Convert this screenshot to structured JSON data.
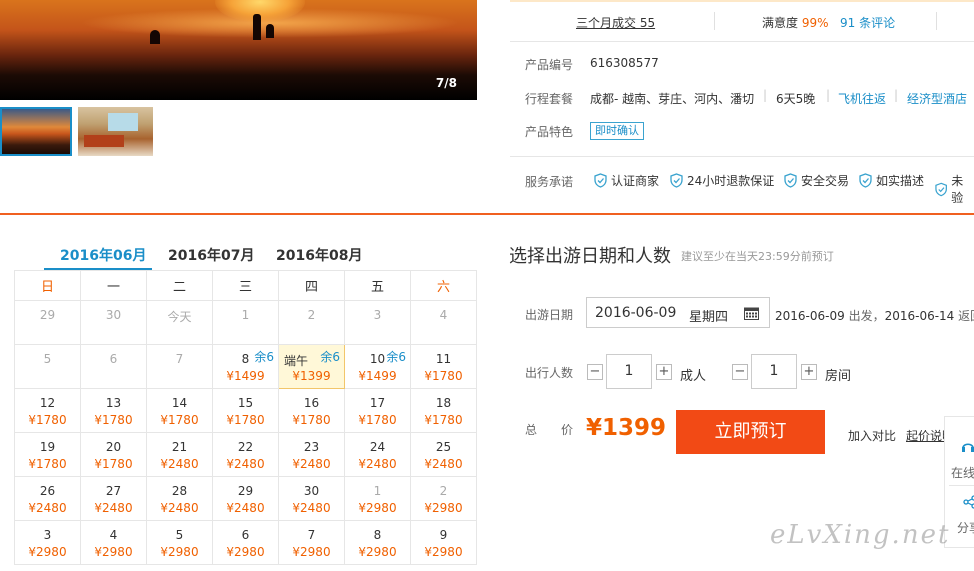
{
  "gallery": {
    "counter": "7/8"
  },
  "stats": {
    "sales": "三个月成交 55",
    "satisfaction_label": "满意度 ",
    "satisfaction_value": "99%",
    "reviews": "91 条评论"
  },
  "product": {
    "id_label": "产品编号",
    "id_value": "616308577",
    "route_label": "行程套餐",
    "route_value": "成都- 越南、芽庄、河内、潘切",
    "duration": "6天5晚",
    "flight": "飞机往返",
    "hotel": "经济型酒店",
    "feature_label": "产品特色",
    "feature_tag": "即时确认",
    "service_label": "服务承诺",
    "services": [
      "认证商家",
      "24小时退款保证",
      "安全交易",
      "如实描述",
      "未验"
    ]
  },
  "calendar": {
    "tabs": [
      "2016年06月",
      "2016年07月",
      "2016年08月"
    ],
    "weekdays": [
      "日",
      "一",
      "二",
      "三",
      "四",
      "五",
      "六"
    ],
    "weeks": [
      [
        {
          "d": "29",
          "m": true
        },
        {
          "d": "30",
          "m": true
        },
        {
          "d": "今天",
          "m": true
        },
        {
          "d": "1",
          "m": true
        },
        {
          "d": "2",
          "m": true
        },
        {
          "d": "3",
          "m": true
        },
        {
          "d": "4",
          "m": true
        }
      ],
      [
        {
          "d": "5",
          "m": true
        },
        {
          "d": "6",
          "m": true
        },
        {
          "d": "7",
          "m": true
        },
        {
          "d": "8",
          "p": "¥1499",
          "r": "余6"
        },
        {
          "d": "端午",
          "p": "¥1399",
          "r": "余6",
          "sel": true,
          "hol": true
        },
        {
          "d": "10",
          "p": "¥1499",
          "r": "余6"
        },
        {
          "d": "11",
          "p": "¥1780"
        }
      ],
      [
        {
          "d": "12",
          "p": "¥1780"
        },
        {
          "d": "13",
          "p": "¥1780"
        },
        {
          "d": "14",
          "p": "¥1780"
        },
        {
          "d": "15",
          "p": "¥1780"
        },
        {
          "d": "16",
          "p": "¥1780"
        },
        {
          "d": "17",
          "p": "¥1780"
        },
        {
          "d": "18",
          "p": "¥1780"
        }
      ],
      [
        {
          "d": "19",
          "p": "¥1780"
        },
        {
          "d": "20",
          "p": "¥1780"
        },
        {
          "d": "21",
          "p": "¥2480"
        },
        {
          "d": "22",
          "p": "¥2480"
        },
        {
          "d": "23",
          "p": "¥2480"
        },
        {
          "d": "24",
          "p": "¥2480"
        },
        {
          "d": "25",
          "p": "¥2480"
        }
      ],
      [
        {
          "d": "26",
          "p": "¥2480"
        },
        {
          "d": "27",
          "p": "¥2480"
        },
        {
          "d": "28",
          "p": "¥2480"
        },
        {
          "d": "29",
          "p": "¥2480"
        },
        {
          "d": "30",
          "p": "¥2480"
        },
        {
          "d": "1",
          "p": "¥2980",
          "m": true
        },
        {
          "d": "2",
          "p": "¥2980",
          "m": true
        }
      ],
      [
        {
          "d": "3",
          "p": "¥2980"
        },
        {
          "d": "4",
          "p": "¥2980"
        },
        {
          "d": "5",
          "p": "¥2980"
        },
        {
          "d": "6",
          "p": "¥2980"
        },
        {
          "d": "7",
          "p": "¥2980"
        },
        {
          "d": "8",
          "p": "¥2980"
        },
        {
          "d": "9",
          "p": "¥2980"
        }
      ]
    ]
  },
  "booking": {
    "title": "选择出游日期和人数",
    "hint": "建议至少在当天23:59分前预订",
    "date_label": "出游日期",
    "date_value": "2016-06-09",
    "weekday": "星期四",
    "depart_date": "2016-06-09",
    "depart_text": " 出发，",
    "return_date": "2016-06-14",
    "return_text": " 返回",
    "people_label": "出行人数",
    "adults": "1",
    "adults_unit": "成人",
    "rooms": "1",
    "rooms_unit": "房间",
    "minus": "−",
    "plus": "+",
    "total_label_1": "总",
    "total_label_2": "价",
    "price": "¥1399",
    "book_button": "立即预订",
    "compare": "加入对比",
    "start_price": "起价说明"
  },
  "sidebar": {
    "online": "在线",
    "share": "分享"
  },
  "watermark": "eLvXing.net"
}
